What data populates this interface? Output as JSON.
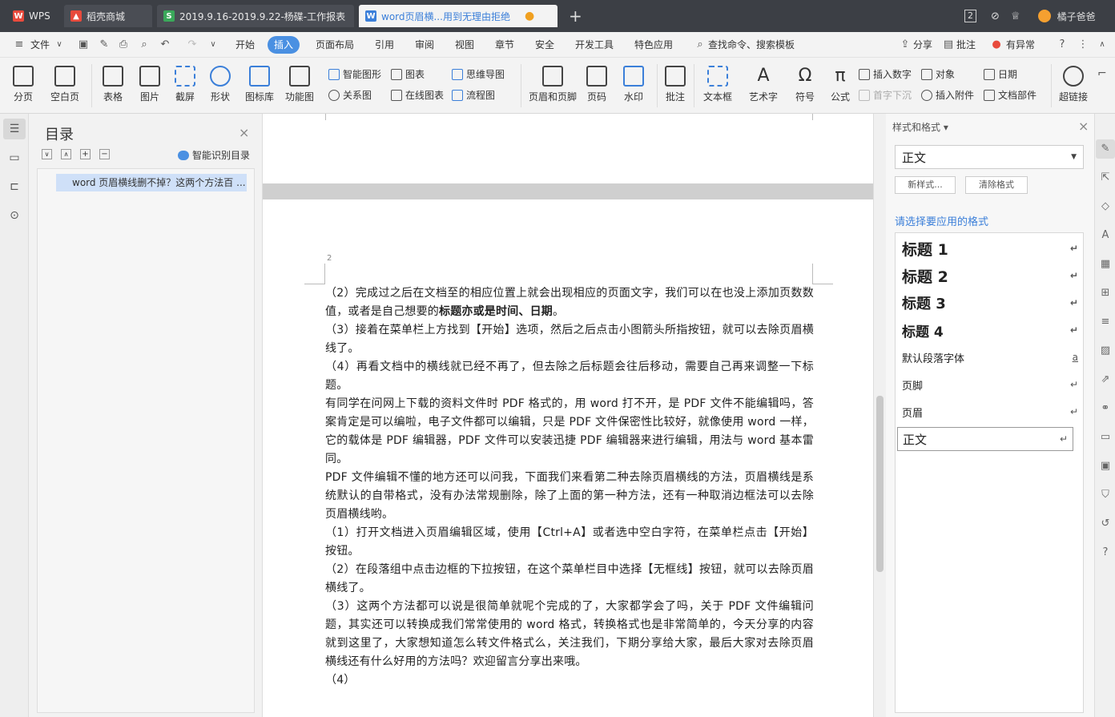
{
  "tabs": [
    {
      "label": "WPS",
      "icon": "wps-logo-icon"
    },
    {
      "label": "稻壳商城",
      "icon": "flame-icon"
    },
    {
      "label": "2019.9.16-2019.9.22-杨碟-工作报表",
      "icon": "spreadsheet-icon"
    },
    {
      "label": "word页眉横...用到无理由拒绝",
      "icon": "word-doc-icon"
    }
  ],
  "tab_count": "2",
  "user_name": "橘子爸爸",
  "menu": {
    "file": "文件",
    "items": [
      "开始",
      "插入",
      "页面布局",
      "引用",
      "审阅",
      "视图",
      "章节",
      "安全",
      "开发工具",
      "特色应用"
    ],
    "active": "插入",
    "search": "查找命令、搜索模板",
    "share": "分享",
    "comment": "批注",
    "anomaly": "有异常"
  },
  "ribbon": {
    "page_break": "分页",
    "blank_page": "空白页",
    "table": "表格",
    "picture": "图片",
    "screenshot": "截屏",
    "shape": "形状",
    "icon_lib": "图标库",
    "func_chart": "功能图",
    "smart_graphic": "智能图形",
    "chart": "图表",
    "relation": "关系图",
    "online_chart": "在线图表",
    "mindmap": "思维导图",
    "flowchart": "流程图",
    "header_footer": "页眉和页脚",
    "page_num": "页码",
    "watermark": "水印",
    "comment": "批注",
    "textbox": "文本框",
    "wordart": "艺术字",
    "symbol": "符号",
    "formula": "公式",
    "insert_number": "插入数字",
    "drop_cap": "首字下沉",
    "object": "对象",
    "attachment": "插入附件",
    "date": "日期",
    "doc_parts": "文档部件",
    "hyperlink": "超链接"
  },
  "toc": {
    "title": "目录",
    "smart": "智能识别目录",
    "item": "word 页眉横线删不掉？这两个方法百 ..."
  },
  "document": {
    "page_number": "2",
    "paragraphs": [
      {
        "text": "（2）完成过之后在文档至的相应位置上就会出现相应的页面文字，我们可以在也没上添加页数数值，或者是自己想要的",
        "bold": "标题亦或是时间、日期",
        "tail": "。"
      },
      {
        "text": "（3）接着在菜单栏上方找到【开始】选项，然后之后点击小图箭头所指按钮，就可以去除页眉横线了。"
      },
      {
        "text": "（4）再看文档中的横线就已经不再了，但去除之后标题会往后移动，需要自己再来调整一下标题。"
      },
      {
        "text": "有同学在问网上下载的资料文件时 PDF 格式的，用 word 打不开，是 PDF 文件不能编辑吗，答案肯定是可以编啦，电子文件都可以编辑，只是 PDF 文件保密性比较好，就像使用 word 一样，它的载体是 PDF 编辑器，PDF 文件可以安装迅捷 PDF 编辑器来进行编辑，用法与 word 基本雷同。"
      },
      {
        "text": "PDF 文件编辑不懂的地方还可以问我，下面我们来看第二种去除页眉横线的方法，页眉横线是系统默认的自带格式，没有办法常规删除，除了上面的第一种方法，还有一种取消边框法可以去除页眉横线哟。"
      },
      {
        "text": "（1）打开文档进入页眉编辑区域，使用【Ctrl+A】或者选中空白字符，在菜单栏点击【开始】按钮。"
      },
      {
        "text": "（2）在段落组中点击边框的下拉按钮，在这个菜单栏目中选择【无框线】按钮，就可以去除页眉横线了。"
      },
      {
        "text": "（3）这两个方法都可以说是很简单就呢个完成的了，大家都学会了吗，关于 PDF 文件编辑问题，其实还可以转换成我们常常使用的 word 格式，转换格式也是非常简单的，今天分享的内容就到这里了，大家想知道怎么转文件格式么，关注我们，下期分享给大家，最后大家对去除页眉横线还有什么好用的方法吗？欢迎留言分享出来哦。"
      },
      {
        "text": "（4）"
      }
    ]
  },
  "style_panel": {
    "header": "样式和格式",
    "current_style": "正文",
    "new_style": "新样式...",
    "clear_format": "清除格式",
    "apply_label": "请选择要应用的格式",
    "styles": [
      {
        "name": "标题  1",
        "mark": "↵"
      },
      {
        "name": "标题  2",
        "mark": "↵"
      },
      {
        "name": "标题  3",
        "mark": "↵"
      },
      {
        "name": "标题  4",
        "mark": "↵"
      },
      {
        "name": "默认段落字体",
        "mark": "a"
      },
      {
        "name": "页脚",
        "mark": "↵"
      },
      {
        "name": "页眉",
        "mark": "↵"
      },
      {
        "name": "正文",
        "mark": "↵"
      }
    ]
  },
  "colors": {
    "accent": "#4a90e2",
    "tabbar": "#3c3f45",
    "wps_red": "#e84a3c",
    "sheet_green": "#3aa85a",
    "doc_blue": "#3b7fd9"
  }
}
